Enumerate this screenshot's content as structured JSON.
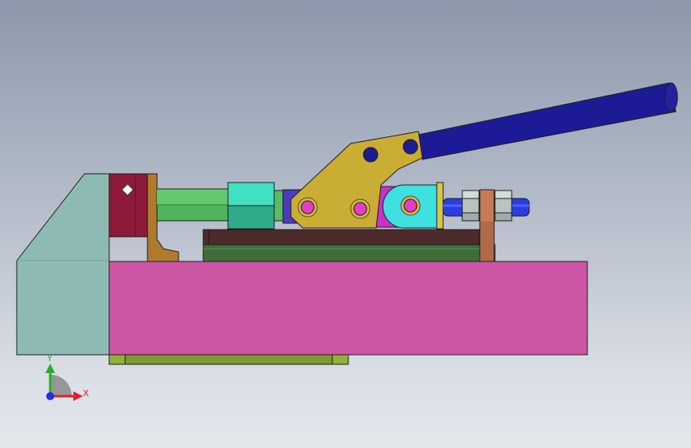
{
  "viewport": {
    "background_top": "#8c98ab",
    "background_bottom": "#e4e7ec"
  },
  "triad": {
    "x_label": "X",
    "y_label": "Y",
    "x_color": "#e0202a",
    "y_color": "#22b022",
    "z_color": "#2a2ae0"
  },
  "parts": {
    "base_block_color": "#cc55a4",
    "end_block_color": "#8dbbb3",
    "handle_color": "#1d1a96",
    "lever_color": "#c9ad34",
    "link_color": "#c832c8",
    "clevis_color": "#3ee0e0",
    "nut_color": "#40e0c0",
    "rod_color": "#4fb45a",
    "stop_block_color": "#8e1a3a",
    "mount_plate_color": "#4d2b2b",
    "rail_color": "#3e6e38",
    "pin_color": "#e040c8"
  }
}
